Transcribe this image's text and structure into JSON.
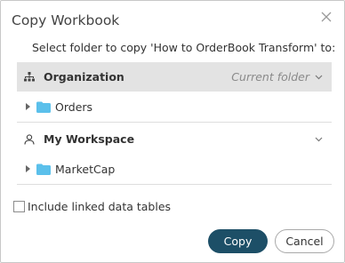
{
  "dialog": {
    "title": "Copy Workbook",
    "prompt": "Select folder to copy 'How to OrderBook Transform' to:"
  },
  "groups": [
    {
      "name": "Organization",
      "status": "Current folder",
      "icon": "organization-icon",
      "folders": [
        {
          "label": "Orders"
        }
      ]
    },
    {
      "name": "My Workspace",
      "status": "",
      "icon": "user-icon",
      "folders": [
        {
          "label": "MarketCap"
        }
      ]
    }
  ],
  "options": {
    "include_linked_label": "Include linked data tables",
    "include_linked_checked": false
  },
  "buttons": {
    "copy": "Copy",
    "cancel": "Cancel"
  },
  "colors": {
    "primary": "#1d4f67",
    "folder": "#5bc0eb",
    "active_row": "#e3e3e3"
  }
}
